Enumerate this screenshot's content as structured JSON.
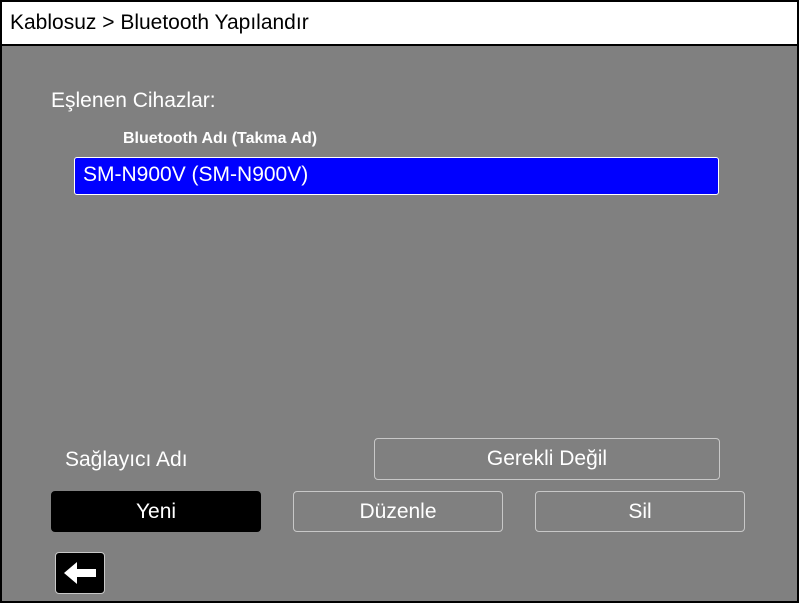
{
  "header": {
    "title": "Kablosuz > Bluetooth Yapılandır"
  },
  "paired": {
    "label": "Eşlenen Cihazlar:",
    "column_header": "Bluetooth Adı (Takma Ad)",
    "devices": [
      {
        "name": "SM-N900V (SM-N900V)",
        "selected": true
      }
    ]
  },
  "provider": {
    "label": "Sağlayıcı Adı",
    "value": "Gerekli Değil"
  },
  "actions": {
    "new_label": "Yeni",
    "edit_label": "Düzenle",
    "delete_label": "Sil"
  },
  "nav": {
    "back_icon": "arrow-left-icon"
  },
  "colors": {
    "background": "#808080",
    "selection": "#0000ff",
    "active_button": "#000000"
  }
}
